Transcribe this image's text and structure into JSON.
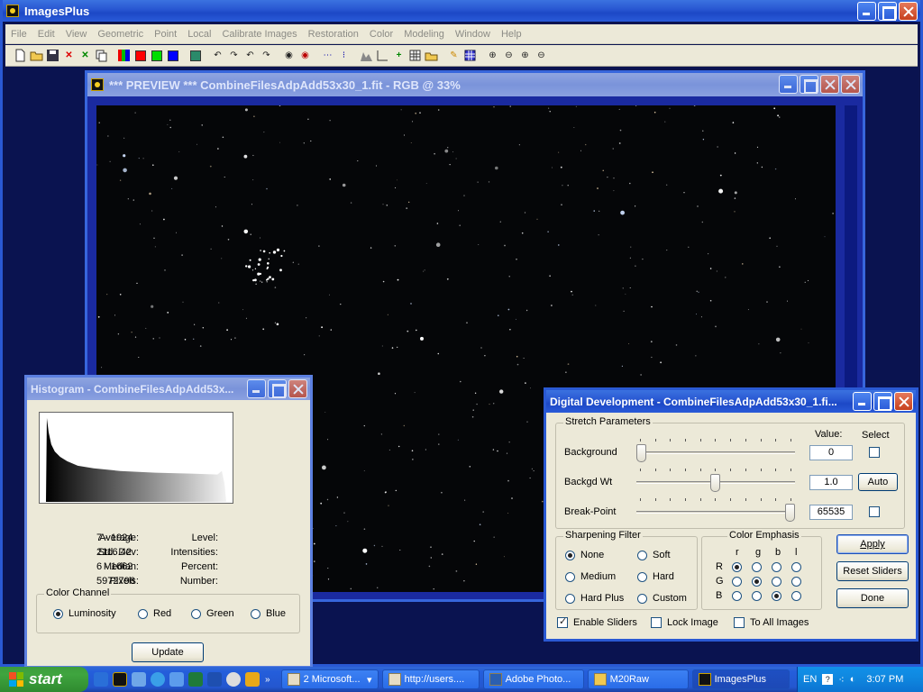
{
  "app": {
    "title": "ImagesPlus",
    "menu": [
      "File",
      "Edit",
      "View",
      "Geometric",
      "Point",
      "Local",
      "Calibrate Images",
      "Restoration",
      "Color",
      "Modeling",
      "Window",
      "Help"
    ]
  },
  "toolbar": {
    "icons": [
      "new-file-icon",
      "open-folder-icon",
      "save-icon",
      "close-red-x-icon",
      "close-green-x-icon",
      "copy-icon",
      "rgb-channels-icon",
      "red-channel-icon",
      "green-channel-icon",
      "blue-channel-icon",
      "calculator-icon",
      "undo-icon",
      "redo-icon",
      "undo-all-icon",
      "redo-all-icon",
      "circle-dot-icon",
      "circle-red-icon",
      "dotted-line-icon",
      "dotted-select-icon",
      "histogram-icon",
      "levels-icon",
      "crosshair-icon",
      "grid-icon",
      "folder-star-icon",
      "pencil-icon",
      "table-icon",
      "zoom-in-icon",
      "zoom-out-icon",
      "zoom-fit-icon",
      "zoom-actual-icon"
    ]
  },
  "preview": {
    "title": "*** PREVIEW *** CombineFilesAdpAdd53x30_1.fit - RGB @ 33%"
  },
  "histogram": {
    "title": "Histogram - CombineFilesAdpAdd53x...",
    "stats": [
      {
        "label": "Average:",
        "value": "7 - 1924"
      },
      {
        "label": "Std. Dev:",
        "value": "2116.42"
      },
      {
        "label": "Median:",
        "value": "6 - 1662"
      },
      {
        "label": "Pixels:",
        "value": "5972796"
      }
    ],
    "right_labels": [
      "Level:",
      "Intensities:",
      "Percent:",
      "Number:"
    ],
    "channel_group": "Color Channel",
    "channels": [
      {
        "label": "Luminosity",
        "selected": true
      },
      {
        "label": "Red",
        "selected": false
      },
      {
        "label": "Green",
        "selected": false
      },
      {
        "label": "Blue",
        "selected": false
      }
    ],
    "update_label": "Update"
  },
  "ddev": {
    "title": "Digital Development - CombineFilesAdpAdd53x30_1.fi...",
    "stretch_group": "Stretch Parameters",
    "value_header": "Value:",
    "select_header": "Select",
    "sliders": [
      {
        "label": "Background",
        "value": "0",
        "position": 0.0,
        "extra": "checkbox"
      },
      {
        "label": "Backgd Wt",
        "value": "1.0",
        "position": 0.5,
        "extra": "Auto"
      },
      {
        "label": "Break-Point",
        "value": "65535",
        "position": 1.0,
        "extra": "checkbox"
      }
    ],
    "sharpen_group": "Sharpening Filter",
    "sharpen_options": [
      {
        "label": "None",
        "selected": true
      },
      {
        "label": "Soft",
        "selected": false
      },
      {
        "label": "Medium",
        "selected": false
      },
      {
        "label": "Hard",
        "selected": false
      },
      {
        "label": "Hard Plus",
        "selected": false
      },
      {
        "label": "Custom",
        "selected": false
      }
    ],
    "color_group": "Color Emphasis",
    "color_cols": [
      "r",
      "g",
      "b",
      "l"
    ],
    "color_rows": [
      {
        "label": "R",
        "selected_col": 0
      },
      {
        "label": "G",
        "selected_col": 1
      },
      {
        "label": "B",
        "selected_col": 2
      }
    ],
    "buttons": {
      "apply": "Apply",
      "reset": "Reset Sliders",
      "done": "Done"
    },
    "checks": [
      {
        "label": "Enable Sliders",
        "checked": true
      },
      {
        "label": "Lock Image",
        "checked": false
      },
      {
        "label": "To All Images",
        "checked": false
      }
    ]
  },
  "taskbar": {
    "start": "start",
    "tasks": [
      "2 Microsoft...",
      "http://users....",
      "Adobe Photo...",
      "M20Raw",
      "ImagesPlus"
    ],
    "lang": "EN",
    "time": "3:07 PM"
  }
}
